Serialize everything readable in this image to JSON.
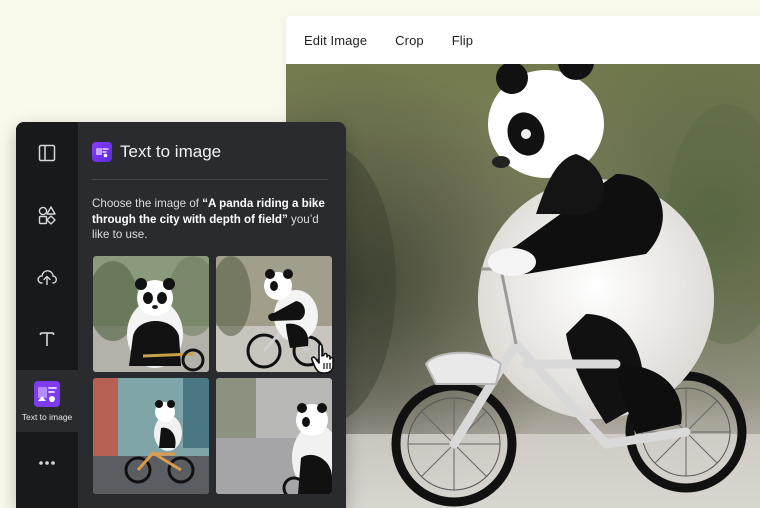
{
  "toolbar": {
    "edit_image": "Edit Image",
    "crop": "Crop",
    "flip": "Flip"
  },
  "sidebar": {
    "items": [
      {
        "icon": "layout-icon"
      },
      {
        "icon": "elements-icon"
      },
      {
        "icon": "upload-icon"
      },
      {
        "icon": "text-icon"
      },
      {
        "icon": "text-to-image-icon",
        "label": "Text to image",
        "active": true
      },
      {
        "icon": "more-icon"
      }
    ]
  },
  "panel": {
    "title": "Text to image",
    "desc_prefix": "Choose the image of ",
    "desc_prompt": "“A panda riding a bike through the city with depth of field”",
    "desc_suffix": " you’d like to use."
  },
  "colors": {
    "accent": "#7d3cf0",
    "panel_bg": "#2a2b2e",
    "rail_bg": "#18191b",
    "page_bg": "#fbf8ec"
  }
}
